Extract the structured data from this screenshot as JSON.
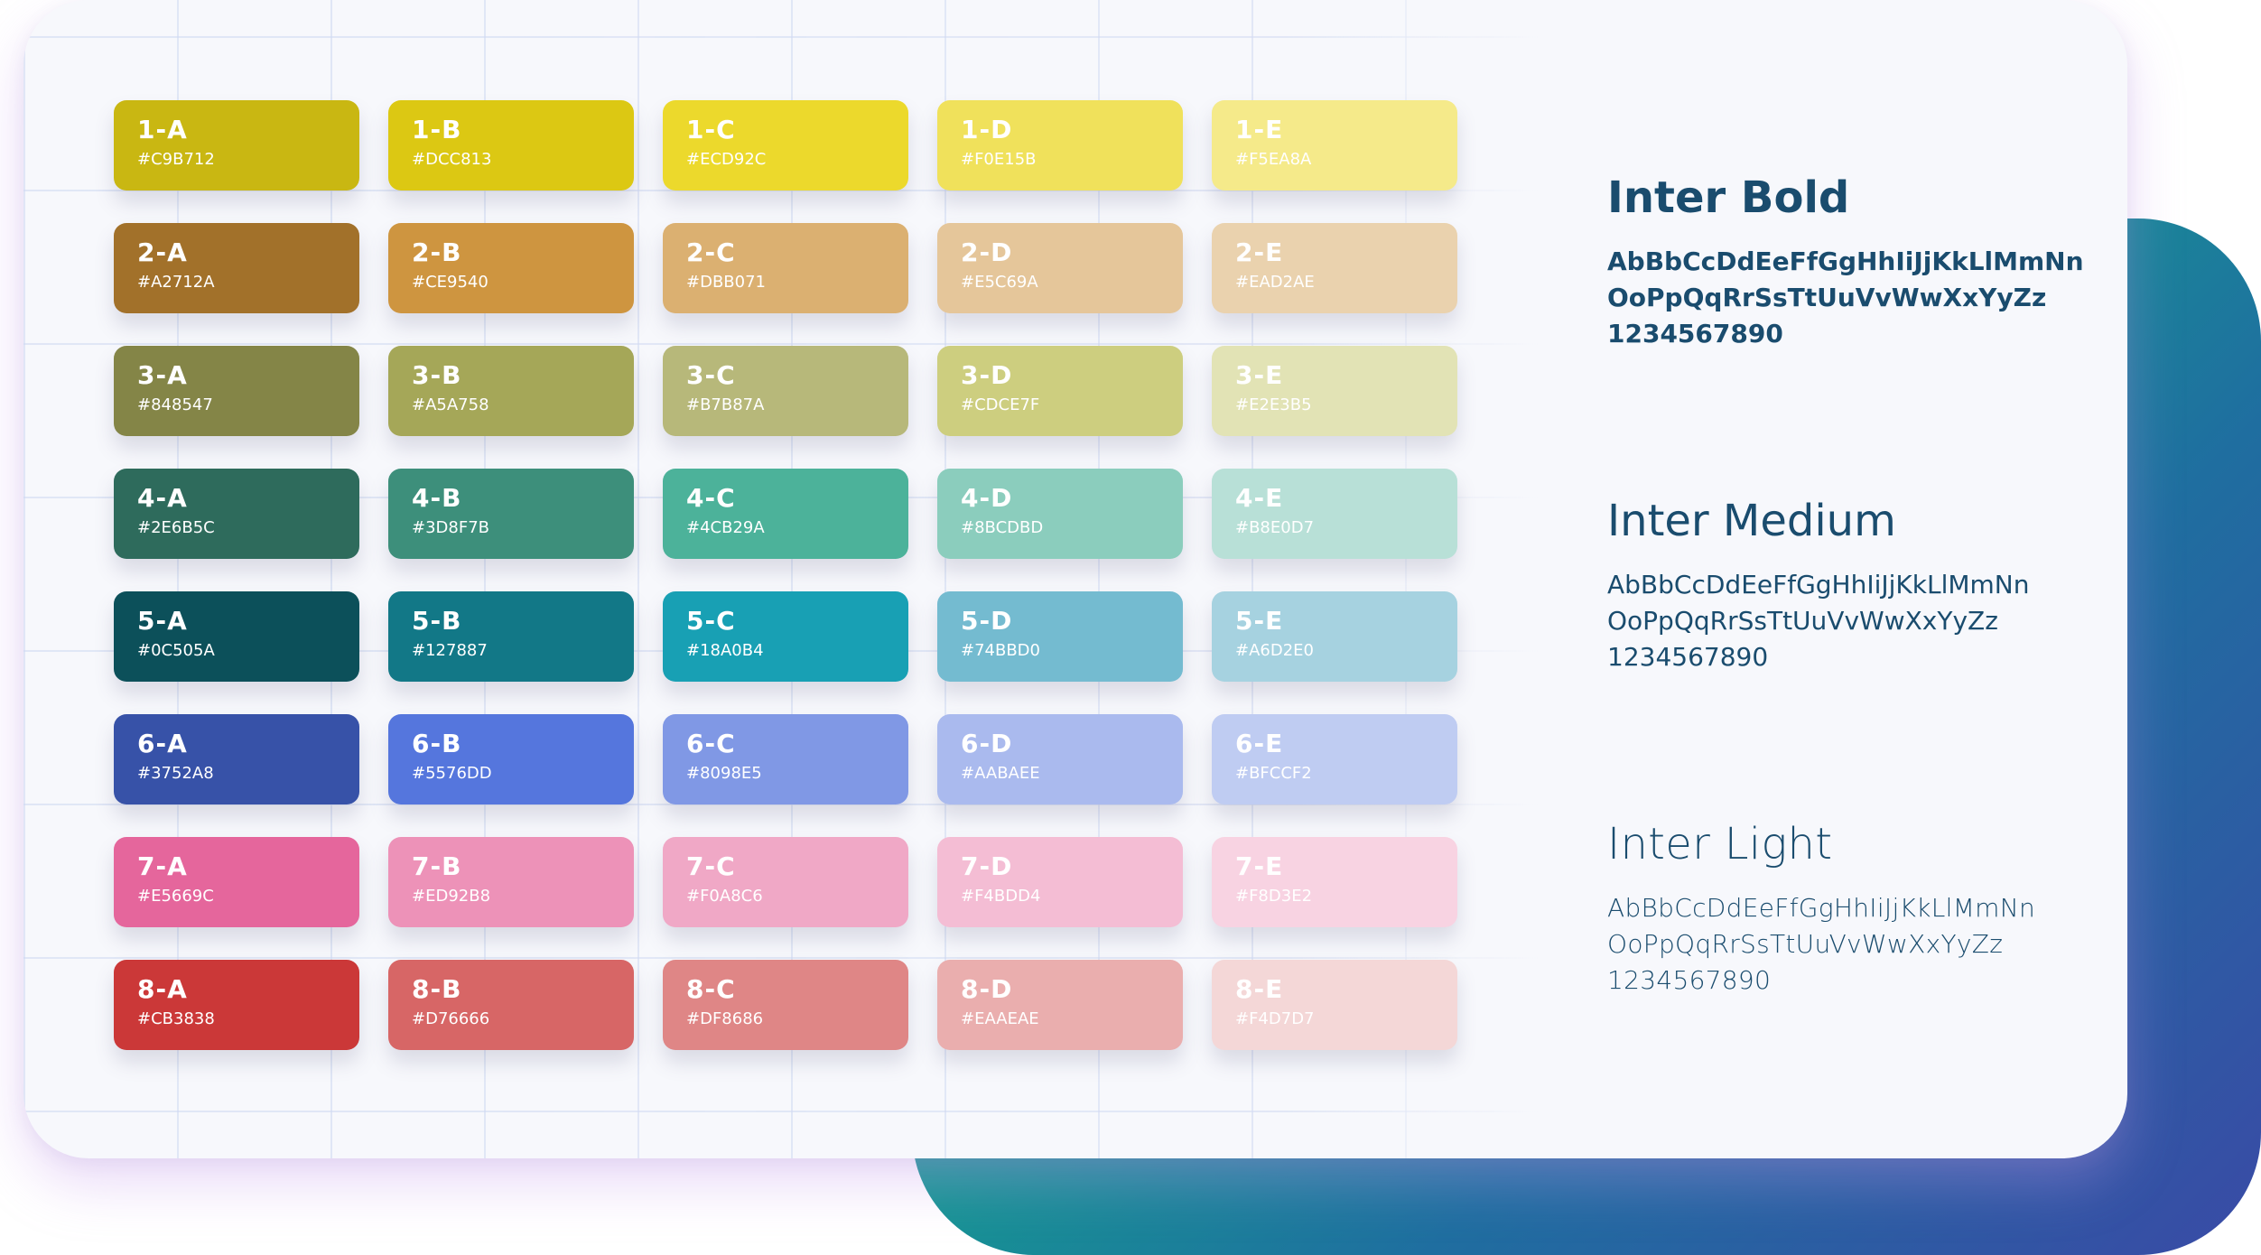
{
  "swatches": [
    {
      "label": "1-A",
      "hex": "#C9B712",
      "color": "#C9B712",
      "text_color": "#ffffff"
    },
    {
      "label": "1-B",
      "hex": "#DCC813",
      "color": "#DCC813",
      "text_color": "#ffffff"
    },
    {
      "label": "1-C",
      "hex": "#ECD92C",
      "color": "#ECD92C",
      "text_color": "#ffffff"
    },
    {
      "label": "1-D",
      "hex": "#F0E15B",
      "color": "#F0E15B",
      "text_color": "#ffffff"
    },
    {
      "label": "1-E",
      "hex": "#F5EA8A",
      "color": "#F5EA8A",
      "text_color": "#ffffff"
    },
    {
      "label": "2-A",
      "hex": "#A2712A",
      "color": "#A2712A",
      "text_color": "#ffffff"
    },
    {
      "label": "2-B",
      "hex": "#CE9540",
      "color": "#CE9540",
      "text_color": "#ffffff"
    },
    {
      "label": "2-C",
      "hex": "#DBB071",
      "color": "#DBB071",
      "text_color": "#ffffff"
    },
    {
      "label": "2-D",
      "hex": "#E5C69A",
      "color": "#E5C69A",
      "text_color": "#ffffff"
    },
    {
      "label": "2-E",
      "hex": "#EAD2AE",
      "color": "#EAD2AE",
      "text_color": "#ffffff"
    },
    {
      "label": "3-A",
      "hex": "#848547",
      "color": "#848547",
      "text_color": "#ffffff"
    },
    {
      "label": "3-B",
      "hex": "#A5A758",
      "color": "#A5A758",
      "text_color": "#ffffff"
    },
    {
      "label": "3-C",
      "hex": "#B7B87A",
      "color": "#B7B87A",
      "text_color": "#ffffff"
    },
    {
      "label": "3-D",
      "hex": "#CDCE7F",
      "color": "#CDCE7F",
      "text_color": "#ffffff"
    },
    {
      "label": "3-E",
      "hex": "#E2E3B5",
      "color": "#E2E3B5",
      "text_color": "#ffffff"
    },
    {
      "label": "4-A",
      "hex": "#2E6B5C",
      "color": "#2E6B5C",
      "text_color": "#ffffff"
    },
    {
      "label": "4-B",
      "hex": "#3D8F7B",
      "color": "#3D8F7B",
      "text_color": "#ffffff"
    },
    {
      "label": "4-C",
      "hex": "#4CB29A",
      "color": "#4CB29A",
      "text_color": "#ffffff"
    },
    {
      "label": "4-D",
      "hex": "#8BCDBD",
      "color": "#8BCDBD",
      "text_color": "#ffffff"
    },
    {
      "label": "4-E",
      "hex": "#B8E0D7",
      "color": "#B8E0D7",
      "text_color": "#ffffff"
    },
    {
      "label": "5-A",
      "hex": "#0C505A",
      "color": "#0C505A",
      "text_color": "#ffffff"
    },
    {
      "label": "5-B",
      "hex": "#127887",
      "color": "#127887",
      "text_color": "#ffffff"
    },
    {
      "label": "5-C",
      "hex": "#18A0B4",
      "color": "#18A0B4",
      "text_color": "#ffffff"
    },
    {
      "label": "5-D",
      "hex": "#74BBD0",
      "color": "#74BBD0",
      "text_color": "#ffffff"
    },
    {
      "label": "5-E",
      "hex": "#A6D2E0",
      "color": "#A6D2E0",
      "text_color": "#ffffff"
    },
    {
      "label": "6-A",
      "hex": "#3752A8",
      "color": "#3752A8",
      "text_color": "#ffffff"
    },
    {
      "label": "6-B",
      "hex": "#5576DD",
      "color": "#5576DD",
      "text_color": "#ffffff"
    },
    {
      "label": "6-C",
      "hex": "#8098E5",
      "color": "#8098E5",
      "text_color": "#ffffff"
    },
    {
      "label": "6-D",
      "hex": "#AABAEE",
      "color": "#AABAEE",
      "text_color": "#ffffff"
    },
    {
      "label": "6-E",
      "hex": "#BFCCF2",
      "color": "#BFCCF2",
      "text_color": "#ffffff"
    },
    {
      "label": "7-A",
      "hex": "#E5669C",
      "color": "#E5669C",
      "text_color": "#ffffff"
    },
    {
      "label": "7-B",
      "hex": "#ED92B8",
      "color": "#ED92B8",
      "text_color": "#ffffff"
    },
    {
      "label": "7-C",
      "hex": "#F0A8C6",
      "color": "#F0A8C6",
      "text_color": "#ffffff"
    },
    {
      "label": "7-D",
      "hex": "#F4BDD4",
      "color": "#F4BDD4",
      "text_color": "#ffffff"
    },
    {
      "label": "7-E",
      "hex": "#F8D3E2",
      "color": "#F8D3E2",
      "text_color": "#ffffff"
    },
    {
      "label": "8-A",
      "hex": "#CB3838",
      "color": "#CB3838",
      "text_color": "#ffffff"
    },
    {
      "label": "8-B",
      "hex": "#D76666",
      "color": "#D76666",
      "text_color": "#ffffff"
    },
    {
      "label": "8-C",
      "hex": "#DF8686",
      "color": "#DF8686",
      "text_color": "#ffffff"
    },
    {
      "label": "8-D",
      "hex": "#EAAEAE",
      "color": "#EAAEAE",
      "text_color": "#ffffff"
    },
    {
      "label": "8-E",
      "hex": "#F4D7D7",
      "color": "#F4D7D7",
      "text_color": "#ffffff"
    }
  ],
  "typography": {
    "bold": {
      "title": "Inter Bold",
      "line1": "AbBbCcDdEeFfGgHhIiJjKkLlMmNn",
      "line2": "OoPpQqRrSsTtUuVvWwXxYyZz",
      "line3": "1234567890"
    },
    "medium": {
      "title": "Inter Medium",
      "line1": "AbBbCcDdEeFfGgHhIiJjKkLlMmNn",
      "line2": "OoPpQqRrSsTtUuVvWwXxYyZz",
      "line3": "1234567890"
    },
    "light": {
      "title": "Inter Light",
      "line1": "AbBbCcDdEeFfGgHhIiJjKkLlMmNn",
      "line2": "OoPpQqRrSsTtUuVvWwXxYyZz",
      "line3": "1234567890"
    }
  },
  "colors": {
    "text_primary": "#1a4c6e",
    "card_background": "#f7f8fc",
    "back_card_gradient": [
      "#18b39a",
      "#1f6ea0",
      "#3a4aa6"
    ]
  }
}
